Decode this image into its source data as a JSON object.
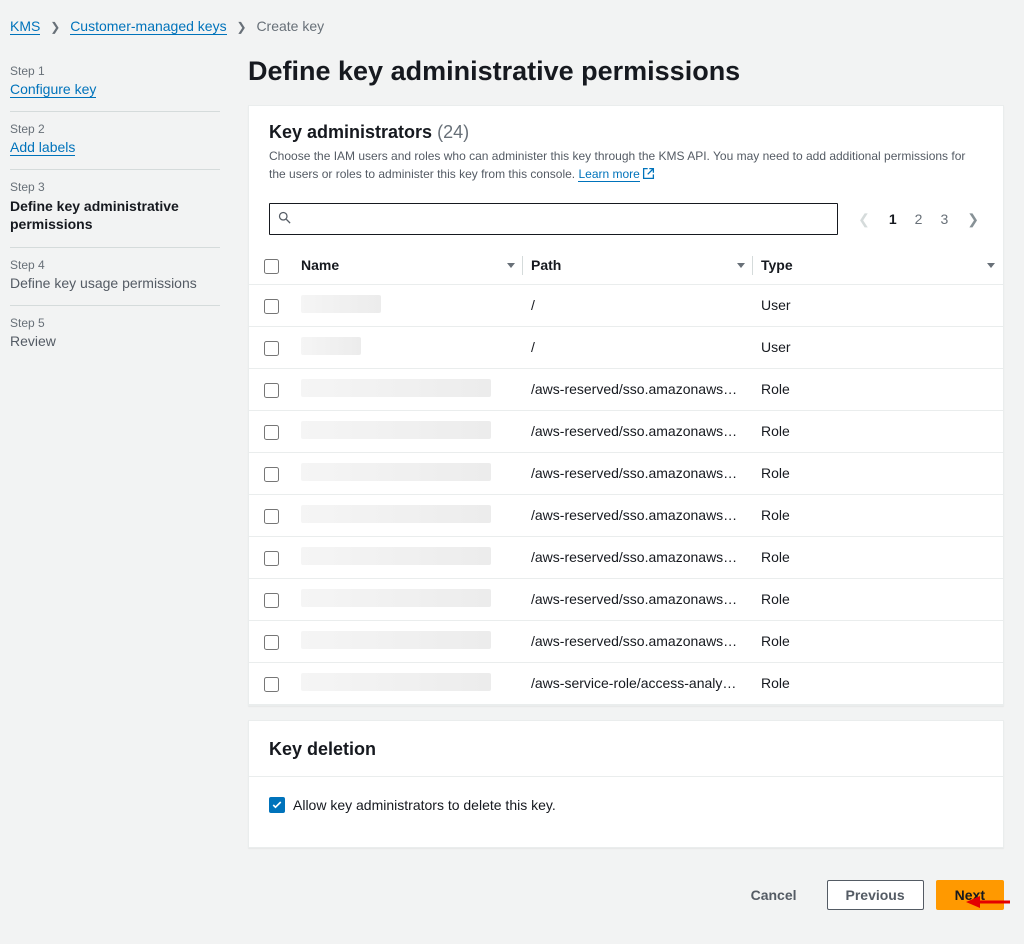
{
  "breadcrumb": {
    "kms": "KMS",
    "cmk": "Customer-managed keys",
    "current": "Create key"
  },
  "sidebar": {
    "steps": [
      {
        "num": "Step 1",
        "label": "Configure key",
        "mode": "link"
      },
      {
        "num": "Step 2",
        "label": "Add labels",
        "mode": "link"
      },
      {
        "num": "Step 3",
        "label": "Define key administrative permissions",
        "mode": "active"
      },
      {
        "num": "Step 4",
        "label": "Define key usage permissions",
        "mode": "inactive"
      },
      {
        "num": "Step 5",
        "label": "Review",
        "mode": "inactive"
      }
    ]
  },
  "page_title": "Define key administrative permissions",
  "admins": {
    "title": "Key administrators",
    "count": "(24)",
    "description": "Choose the IAM users and roles who can administer this key through the KMS API. You may need to add additional permissions for the users or roles to administer this key from this console. ",
    "learn_more": "Learn more",
    "search_placeholder": "",
    "pagination": {
      "prev_disabled": true,
      "pages": [
        "1",
        "2",
        "3"
      ],
      "current": "1"
    },
    "columns": {
      "name": "Name",
      "path": "Path",
      "type": "Type"
    },
    "rows": [
      {
        "name_w": 80,
        "path": "/",
        "type": "User"
      },
      {
        "name_w": 60,
        "path": "/",
        "type": "User"
      },
      {
        "name_w": 190,
        "path": "/aws-reserved/sso.amazonaws…",
        "type": "Role"
      },
      {
        "name_w": 190,
        "path": "/aws-reserved/sso.amazonaws…",
        "type": "Role"
      },
      {
        "name_w": 190,
        "path": "/aws-reserved/sso.amazonaws…",
        "type": "Role"
      },
      {
        "name_w": 190,
        "path": "/aws-reserved/sso.amazonaws…",
        "type": "Role"
      },
      {
        "name_w": 190,
        "path": "/aws-reserved/sso.amazonaws…",
        "type": "Role"
      },
      {
        "name_w": 190,
        "path": "/aws-reserved/sso.amazonaws…",
        "type": "Role"
      },
      {
        "name_w": 190,
        "path": "/aws-reserved/sso.amazonaws…",
        "type": "Role"
      },
      {
        "name_w": 190,
        "path": "/aws-service-role/access-analy…",
        "type": "Role"
      }
    ]
  },
  "deletion": {
    "title": "Key deletion",
    "allow_label": "Allow key administrators to delete this key.",
    "checked": true
  },
  "footer": {
    "cancel": "Cancel",
    "previous": "Previous",
    "next": "Next"
  }
}
